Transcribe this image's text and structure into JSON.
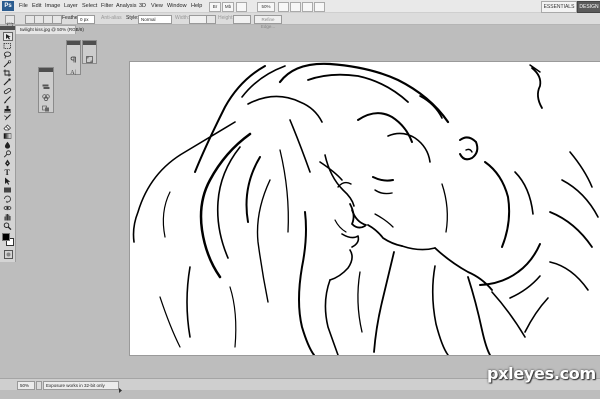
{
  "app": {
    "logo": "Ps",
    "menus": [
      "File",
      "Edit",
      "Image",
      "Layer",
      "Select",
      "Filter",
      "Analysis",
      "3D",
      "View",
      "Window",
      "Help"
    ],
    "zoom_box": "50%",
    "workspace_label": "ESSENTIALS",
    "design_label": "DESIGN"
  },
  "options_bar": {
    "feather_label": "Feather:",
    "feather_value": "0 px",
    "antialias_label": "Anti-alias",
    "style_label": "Style:",
    "style_value": "Normal",
    "width_label": "Width:",
    "height_label": "Height:",
    "refine_edge_label": "Refine Edge..."
  },
  "document": {
    "tab_title": "twilight kiss.jpg @ 50% (RGB/8)"
  },
  "status_bar": {
    "zoom": "50%",
    "info": "Exposure works in 32-bit only"
  },
  "watermark": "pxleyes.com",
  "colors": {
    "foreground": "#000000",
    "background": "#ffffff",
    "panel_header": "#4f4f4f",
    "ps_logo": "#2b5c8f"
  },
  "icons": [
    "marquee-icon",
    "lasso-icon",
    "crop-icon",
    "eyedropper-icon",
    "healing-icon",
    "brush-icon",
    "stamp-icon",
    "history-brush-icon",
    "eraser-icon",
    "gradient-icon",
    "blur-icon",
    "dodge-icon",
    "pen-icon",
    "type-icon",
    "path-select-icon",
    "shape-icon",
    "3d-rotate-icon",
    "3d-orbit-icon",
    "hand-icon",
    "zoom-icon"
  ]
}
